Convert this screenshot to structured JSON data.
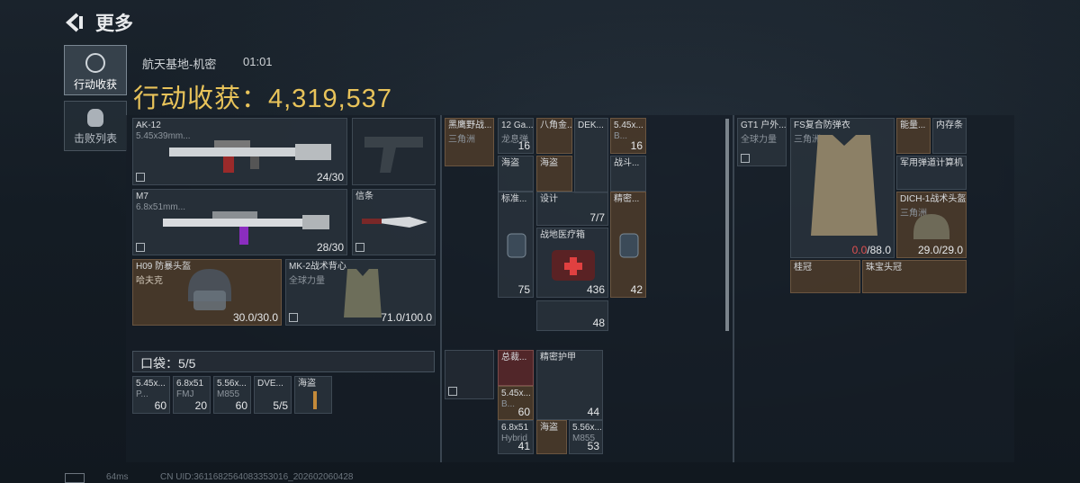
{
  "header": {
    "title": "更多",
    "back_icon": "back-arrow-icon"
  },
  "tabs": [
    {
      "label": "行动收获",
      "icon": "loot-icon",
      "active": true
    },
    {
      "label": "击败列表",
      "icon": "skull-icon",
      "active": false
    }
  ],
  "match": {
    "map": "航天基地-机密",
    "time": "01:01"
  },
  "harvest": {
    "label": "行动收获：4,319,537"
  },
  "weapons": [
    {
      "name": "AK-12",
      "sub": "5.45x39mm...",
      "ammo": "24/30"
    },
    {
      "name": "M7",
      "sub": "6.8x51mm...",
      "ammo": "28/30"
    },
    {
      "name": "信条"
    }
  ],
  "armor": [
    {
      "name": "H09 防暴头盔",
      "sub": "哈夫克",
      "dur": "30.0/30.0"
    },
    {
      "name": "MK-2战术背心",
      "sub": "全球力量",
      "dur": "71.0/100.0"
    }
  ],
  "pocket": {
    "label": "口袋：5/5",
    "items": [
      {
        "name": "5.45x...",
        "sub": "P...",
        "count": "60"
      },
      {
        "name": "6.8x51",
        "sub": "FMJ",
        "count": "20"
      },
      {
        "name": "5.56x...",
        "sub": "M855",
        "count": "60"
      },
      {
        "name": "DVE...",
        "sub": "",
        "count": "5/5"
      },
      {
        "name": "海盗",
        "sub": "",
        "count": ""
      }
    ]
  },
  "backpack": [
    {
      "name": "黑鹰野战...",
      "sub": "三角洲",
      "count": ""
    },
    {
      "name": "12 Ga...",
      "sub": "龙息弹",
      "count": "16"
    },
    {
      "name": "八角金...",
      "sub": "",
      "count": ""
    },
    {
      "name": "DEK...",
      "sub": "",
      "count": ""
    },
    {
      "name": "5.45x...",
      "sub": "B...",
      "count": "16"
    },
    {
      "name": "海盗",
      "sub": "",
      "count": ""
    },
    {
      "name": "海盗",
      "sub": "",
      "count": ""
    },
    {
      "name": "战斗...",
      "sub": "",
      "count": ""
    },
    {
      "name": "标准...",
      "sub": "",
      "count": "75"
    },
    {
      "name": "设计",
      "sub": "",
      "count": "7/7"
    },
    {
      "name": "精密...",
      "sub": "",
      "count": "42"
    },
    {
      "name": "战地医疗箱",
      "sub": "",
      "count": "436"
    },
    {
      "name": "",
      "sub": "",
      "count": "48"
    }
  ],
  "chest": [
    {
      "name": "总裁...",
      "sub": "",
      "count": ""
    },
    {
      "name": "精密护甲",
      "sub": "",
      "count": "44"
    },
    {
      "name": "5.45x...",
      "sub": "B...",
      "count": "60"
    },
    {
      "name": "6.8x51",
      "sub": "Hybrid",
      "count": "41"
    },
    {
      "name": "海盗",
      "sub": "",
      "count": ""
    },
    {
      "name": "5.56x...",
      "sub": "M855",
      "count": "53"
    }
  ],
  "gear": [
    {
      "name": "GT1 户外...",
      "sub": "全球力量"
    },
    {
      "name": "FS复合防弹衣",
      "sub": "三角洲",
      "dur_red": "0.0",
      "dur": "/88.0"
    },
    {
      "name": "能量...",
      "sub": ""
    },
    {
      "name": "内存条",
      "sub": ""
    },
    {
      "name": "军用弹道计算机",
      "sub": ""
    },
    {
      "name": "DICH-1战术头盔",
      "sub": "三角洲",
      "dur": "29.0/29.0"
    },
    {
      "name": "桂冠",
      "sub": ""
    },
    {
      "name": "珠宝头冠",
      "sub": ""
    }
  ],
  "footer": {
    "ping": "64ms",
    "uid": "CN UID:3611682564083353016_202602060428"
  }
}
